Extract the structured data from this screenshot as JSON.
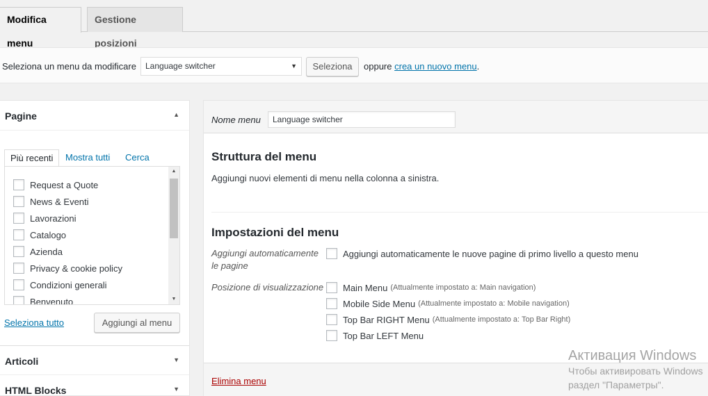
{
  "tabs": {
    "edit_menu": "Modifica menu",
    "manage_locations": "Gestione posizioni"
  },
  "select_bar": {
    "label": "Seleziona un menu da modificare",
    "selected_menu": "Language switcher",
    "select_button": "Seleziona",
    "or_text": "oppure",
    "create_link": "crea un nuovo menu",
    "period": "."
  },
  "left_panel": {
    "pages_title": "Pagine",
    "subtabs": [
      "Più recenti",
      "Mostra tutti",
      "Cerca"
    ],
    "pages": [
      "Request a Quote",
      "News & Eventi",
      "Lavorazioni",
      "Catalogo",
      "Azienda",
      "Privacy & cookie policy",
      "Condizioni generali",
      "Benvenuto"
    ],
    "select_all": "Seleziona tutto",
    "add_to_menu": "Aggiungi al menu",
    "articles_title": "Articoli",
    "html_blocks_title": "HTML Blocks"
  },
  "right_panel": {
    "menu_name_label": "Nome menu",
    "menu_name_value": "Language switcher",
    "structure_title": "Struttura del menu",
    "structure_desc": "Aggiungi nuovi elementi di menu nella colonna a sinistra.",
    "settings_title": "Impostazioni del menu",
    "auto_add_label": "Aggiungi automaticamente le pagine",
    "auto_add_option": "Aggiungi automaticamente le nuove pagine di primo livello a questo menu",
    "display_location_label": "Posizione di visualizzazione",
    "locations": [
      {
        "name": "Main Menu",
        "note": "(Attualmente impostato a: Main navigation)"
      },
      {
        "name": "Mobile Side Menu",
        "note": "(Attualmente impostato a: Mobile navigation)"
      },
      {
        "name": "Top Bar RIGHT Menu",
        "note": "(Attualmente impostato a: Top Bar Right)"
      },
      {
        "name": "Top Bar LEFT Menu",
        "note": ""
      }
    ],
    "delete_menu": "Elimina menu"
  },
  "watermark": {
    "title": "Активация Windows",
    "line1": "Чтобы активировать Windows",
    "line2": "раздел \"Параметры\"."
  },
  "icons": {
    "collapse": "▲",
    "expand": "▼",
    "dropdown": "▼"
  }
}
